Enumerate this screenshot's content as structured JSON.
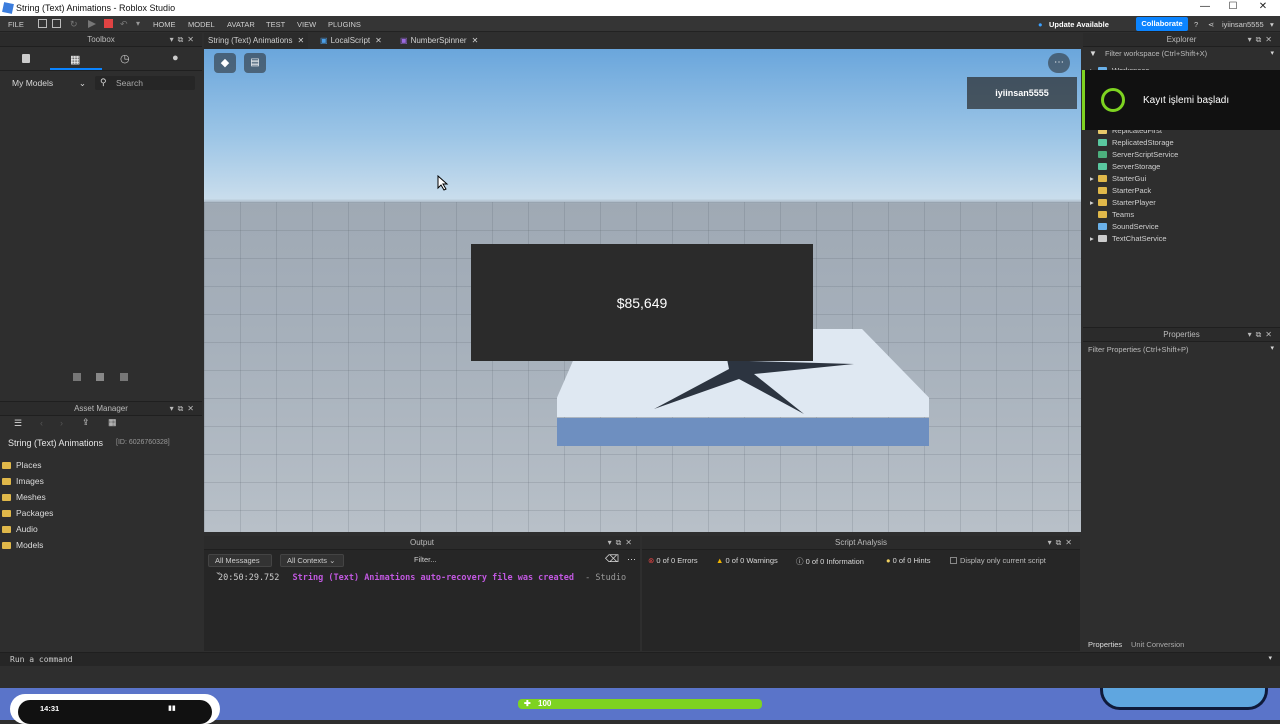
{
  "window": {
    "title": "String (Text) Animations - Roblox Studio"
  },
  "menu": {
    "file": "FILE",
    "home": "HOME",
    "model": "MODEL",
    "avatar": "AVATAR",
    "test": "TEST",
    "view": "VIEW",
    "plugins": "PLUGINS",
    "update": "Update Available",
    "collaborate": "Collaborate",
    "user": "iyiinsan5555"
  },
  "toolbox": {
    "title": "Toolbox",
    "dropdown": "My Models",
    "search_placeholder": "Search"
  },
  "asset_manager": {
    "title": "Asset Manager",
    "place_name": "String (Text) Animations",
    "place_id": "[ID: 6026760328]",
    "folders": [
      "Places",
      "Images",
      "Meshes",
      "Packages",
      "Audio",
      "Models"
    ]
  },
  "editor_tabs": [
    "String (Text) Animations",
    "LocalScript",
    "NumberSpinner"
  ],
  "viewport": {
    "money": "$85,649",
    "player": "iyiinsan5555"
  },
  "notification": {
    "text": "Kayıt işlemi başladı"
  },
  "explorer": {
    "title": "Explorer",
    "filter": "Filter workspace (Ctrl+Shift+X)",
    "items": [
      {
        "label": "Workspace",
        "expandable": true
      },
      {
        "label": "ReplicatedFirst",
        "expandable": false
      },
      {
        "label": "ReplicatedStorage",
        "expandable": false
      },
      {
        "label": "ServerScriptService",
        "expandable": false
      },
      {
        "label": "ServerStorage",
        "expandable": false
      },
      {
        "label": "StarterGui",
        "expandable": true
      },
      {
        "label": "StarterPack",
        "expandable": false
      },
      {
        "label": "StarterPlayer",
        "expandable": true
      },
      {
        "label": "Teams",
        "expandable": false
      },
      {
        "label": "SoundService",
        "expandable": false
      },
      {
        "label": "TextChatService",
        "expandable": true
      }
    ]
  },
  "properties": {
    "title": "Properties",
    "filter": "Filter Properties (Ctrl+Shift+P)",
    "bottom_tabs": [
      "Properties",
      "Unit Conversion"
    ]
  },
  "output": {
    "title": "Output",
    "messages_dropdown": "All Messages",
    "contexts_dropdown": "All Contexts",
    "filter_placeholder": "Filter...",
    "log_time": "20:50:29.752",
    "log_text": "String (Text) Animations auto-recovery file was created",
    "log_source": "- Studio"
  },
  "script_analysis": {
    "title": "Script Analysis",
    "errors": "0 of 0 Errors",
    "warnings": "0 of 0 Warnings",
    "information": "0 of 0 Information",
    "hints": "0 of 0 Hints",
    "current_only": "Display only current script"
  },
  "command_bar": {
    "placeholder": "Run a command"
  },
  "overlay": {
    "clock": "14:31",
    "health": "100"
  },
  "colors": {
    "accent": "#0b84ff",
    "health": "#7ed321",
    "notification_icon": "#7ed321"
  }
}
